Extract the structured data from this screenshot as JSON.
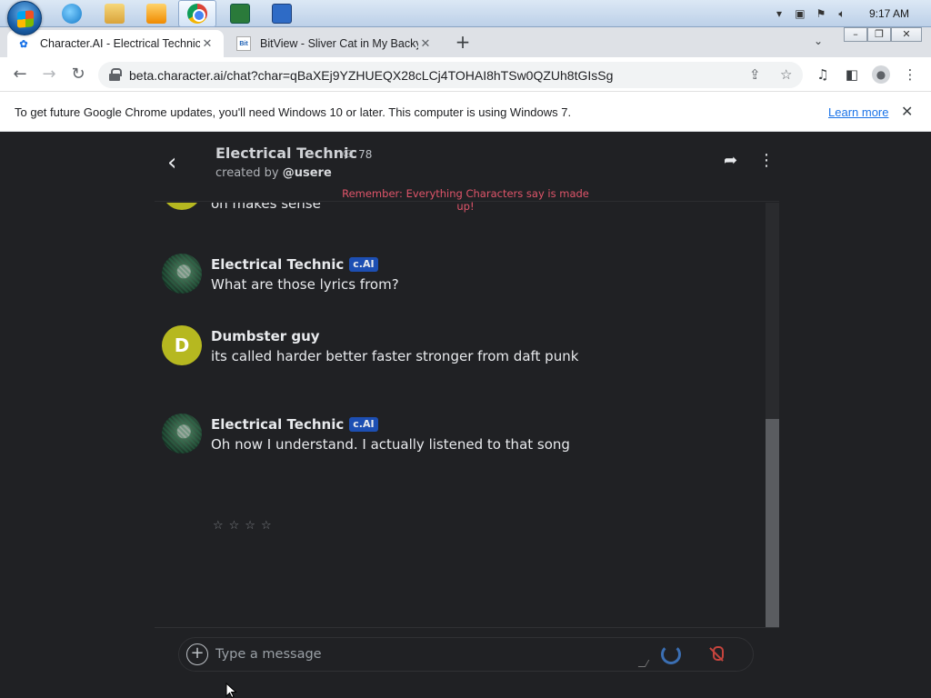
{
  "taskbar": {
    "time": "9:17 AM",
    "icons": [
      "windows-start-icon",
      "internet-explorer-icon",
      "folder-icon",
      "media-player-icon",
      "chrome-icon",
      "app-icon",
      "app-icon"
    ]
  },
  "browser": {
    "tabs": [
      {
        "favicon": "character-ai-icon",
        "title": "Character.AI - Electrical Technic",
        "active": true
      },
      {
        "favicon": "bitview-icon",
        "title": "BitView - Sliver Cat in My Backya",
        "active": false
      }
    ],
    "url": "beta.character.ai/chat?char=qBaXEj9YZHUEQX28cLCj4TOHAI8hTSw0QZUh8tGIsSg"
  },
  "infobar": {
    "message": "To get future Google Chrome updates, you'll need Windows 10 or later. This computer is using Windows 7.",
    "link": "Learn more"
  },
  "chat": {
    "character_name": "Electrical Technic",
    "chat_count": "78",
    "created_by_prefix": "created by",
    "creator": "@usere",
    "disclaimer": "Remember: Everything Characters say is made up!",
    "messages": [
      {
        "sender": "",
        "text": "oh makes sense",
        "avatar": "",
        "badge": ""
      },
      {
        "sender": "Electrical Technic",
        "text": "What are those lyrics from?",
        "avatar": "",
        "badge": "c.AI"
      },
      {
        "sender": "Dumbster guy",
        "text": "its called harder better faster stronger from daft punk",
        "avatar": "D",
        "badge": ""
      },
      {
        "sender": "Electrical Technic",
        "text": "Oh now I understand. I actually listened to that song",
        "avatar": "",
        "badge": "c.AI"
      }
    ],
    "rating_stars": "☆☆☆☆",
    "input_placeholder": "Type a message",
    "accent": "#b6b820",
    "badge_color": "#1d4fb3",
    "disclaimer_color": "#e0556a"
  }
}
